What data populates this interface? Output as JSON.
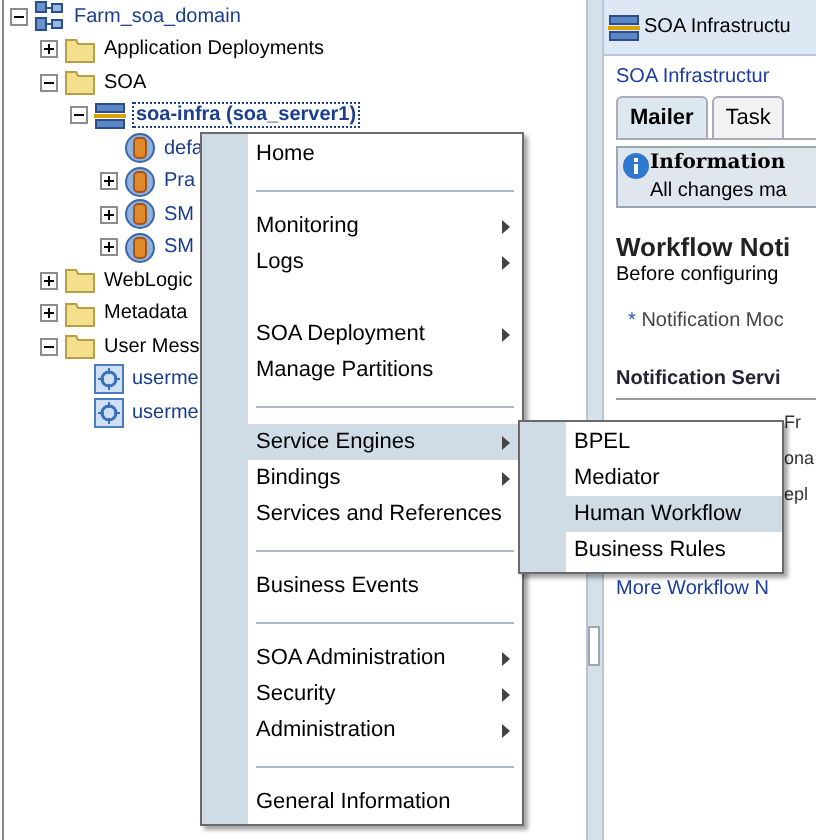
{
  "tree": [
    {
      "label": "Farm_soa_domain",
      "kind": "domain",
      "expanded": true,
      "selected": false,
      "children": [
        {
          "label": "Application Deployments",
          "kind": "folder",
          "expanded": false,
          "selected": false
        },
        {
          "label": "SOA",
          "kind": "folder",
          "expanded": true,
          "selected": false,
          "children": [
            {
              "label": "soa-infra (soa_server1)",
              "kind": "server",
              "expanded": true,
              "selected": true,
              "children": [
                {
                  "label": "defa",
                  "kind": "composite",
                  "selected": false
                },
                {
                  "label": "Pra",
                  "kind": "composite",
                  "expanded": false,
                  "selected": false
                },
                {
                  "label": "SM",
                  "kind": "composite",
                  "expanded": false,
                  "selected": false
                },
                {
                  "label": "SM",
                  "kind": "composite",
                  "expanded": false,
                  "selected": false
                }
              ]
            }
          ]
        },
        {
          "label": "WebLogic",
          "kind": "folder",
          "expanded": false,
          "selected": false
        },
        {
          "label": "Metadata",
          "kind": "folder",
          "expanded": false,
          "selected": false
        },
        {
          "label": "User Mess",
          "kind": "folder",
          "expanded": true,
          "selected": false,
          "children": [
            {
              "label": "userme",
              "kind": "messaging",
              "selected": false
            },
            {
              "label": "userme",
              "kind": "messaging",
              "selected": false
            }
          ]
        }
      ]
    }
  ],
  "context_menu": {
    "items": [
      {
        "kind": "item",
        "label": "Home",
        "submenu": false,
        "selected": false
      },
      {
        "kind": "separator"
      },
      {
        "kind": "item",
        "label": "Monitoring",
        "submenu": true,
        "selected": false
      },
      {
        "kind": "item",
        "label": "Logs",
        "submenu": true,
        "selected": false
      },
      {
        "kind": "gap"
      },
      {
        "kind": "item",
        "label": "SOA Deployment",
        "submenu": true,
        "selected": false
      },
      {
        "kind": "item",
        "label": "Manage Partitions",
        "submenu": false,
        "selected": false
      },
      {
        "kind": "separator"
      },
      {
        "kind": "item",
        "label": "Service Engines",
        "submenu": true,
        "selected": true
      },
      {
        "kind": "item",
        "label": "Bindings",
        "submenu": true,
        "selected": false
      },
      {
        "kind": "item",
        "label": "Services and References",
        "submenu": false,
        "selected": false
      },
      {
        "kind": "separator"
      },
      {
        "kind": "item",
        "label": "Business Events",
        "submenu": false,
        "selected": false
      },
      {
        "kind": "separator"
      },
      {
        "kind": "item",
        "label": "SOA Administration",
        "submenu": true,
        "selected": false
      },
      {
        "kind": "item",
        "label": "Security",
        "submenu": true,
        "selected": false
      },
      {
        "kind": "item",
        "label": "Administration",
        "submenu": true,
        "selected": false
      },
      {
        "kind": "separator"
      },
      {
        "kind": "item",
        "label": "General Information",
        "submenu": false,
        "selected": false
      }
    ]
  },
  "submenu": {
    "items": [
      {
        "label": "BPEL",
        "selected": false
      },
      {
        "label": "Mediator",
        "selected": false
      },
      {
        "label": "Human Workflow",
        "selected": true
      },
      {
        "label": "Business Rules",
        "selected": false
      }
    ]
  },
  "right_panel": {
    "header_title": "SOA Infrastructu",
    "breadcrumb_link": "SOA Infrastructur",
    "tabs": [
      {
        "label": "Mailer",
        "selected": true
      },
      {
        "label": "Task",
        "selected": false
      }
    ],
    "info": {
      "title": "Information",
      "text": "All changes ma"
    },
    "heading": "Workflow Noti",
    "intro": "Before configuring",
    "required_mark": "*",
    "notification_mode_label": "Notification Moc",
    "section_heading": "Notification Servi",
    "fields": [
      "Fr",
      "ona",
      "epl"
    ],
    "more_link": "More Workflow N"
  }
}
